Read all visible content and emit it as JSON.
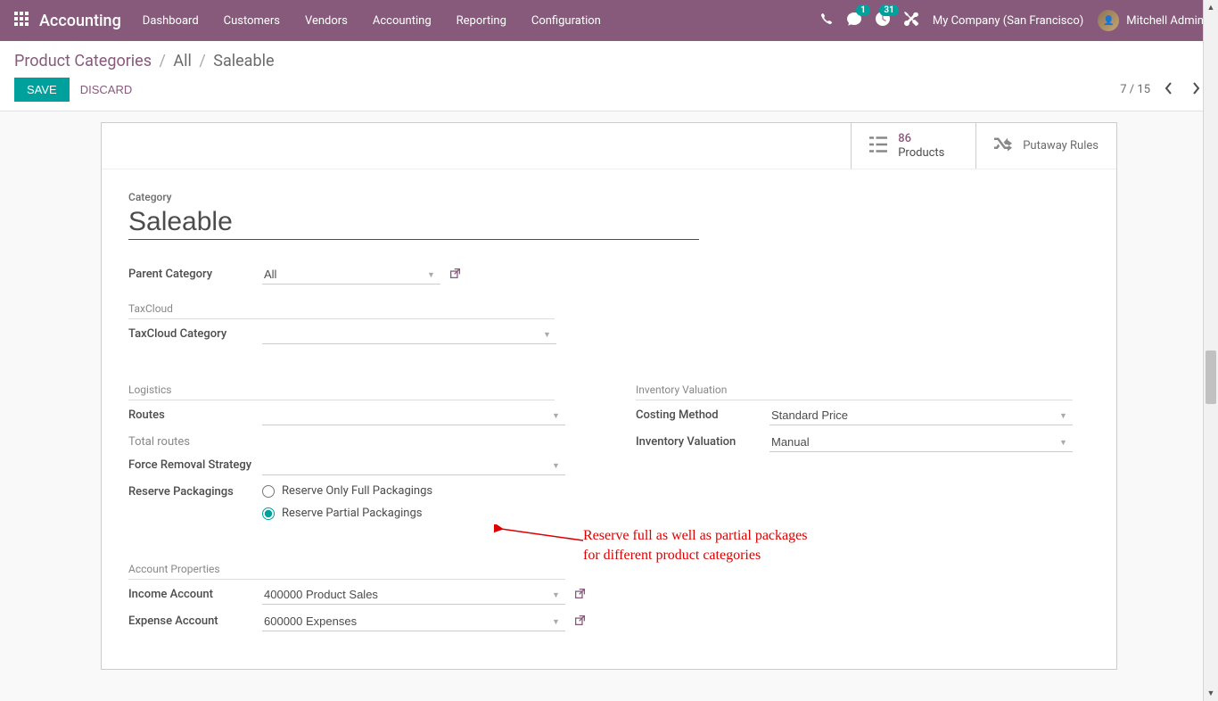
{
  "topbar": {
    "app_name": "Accounting",
    "menu": [
      "Dashboard",
      "Customers",
      "Vendors",
      "Accounting",
      "Reporting",
      "Configuration"
    ],
    "msg_badge": "1",
    "activity_badge": "31",
    "company": "My Company (San Francisco)",
    "user": "Mitchell Admin"
  },
  "breadcrumb": {
    "root": "Product Categories",
    "path1": "All",
    "path2": "Saleable"
  },
  "buttons": {
    "save": "SAVE",
    "discard": "DISCARD"
  },
  "pager": {
    "text": "7 / 15"
  },
  "statbuttons": {
    "products_count": "86",
    "products_label": "Products",
    "putaway_label": "Putaway Rules"
  },
  "form": {
    "category_label": "Category",
    "category_value": "Saleable",
    "parent_category_label": "Parent Category",
    "parent_category_value": "All",
    "taxcloud_section": "TaxCloud",
    "taxcloud_category_label": "TaxCloud Category",
    "taxcloud_category_value": "",
    "logistics_section": "Logistics",
    "routes_label": "Routes",
    "routes_value": "",
    "total_routes_label": "Total routes",
    "force_removal_label": "Force Removal Strategy",
    "force_removal_value": "",
    "reserve_pack_label": "Reserve Packagings",
    "reserve_option1": "Reserve Only Full Packagings",
    "reserve_option2": "Reserve Partial Packagings",
    "inventory_section": "Inventory Valuation",
    "costing_method_label": "Costing Method",
    "costing_method_value": "Standard Price",
    "inv_valuation_label": "Inventory Valuation",
    "inv_valuation_value": "Manual",
    "account_section": "Account Properties",
    "income_account_label": "Income Account",
    "income_account_value": "400000 Product Sales",
    "expense_account_label": "Expense Account",
    "expense_account_value": "600000 Expenses"
  },
  "annotation": {
    "line1": "Reserve full as well as partial packages",
    "line2": "for different product categories"
  }
}
